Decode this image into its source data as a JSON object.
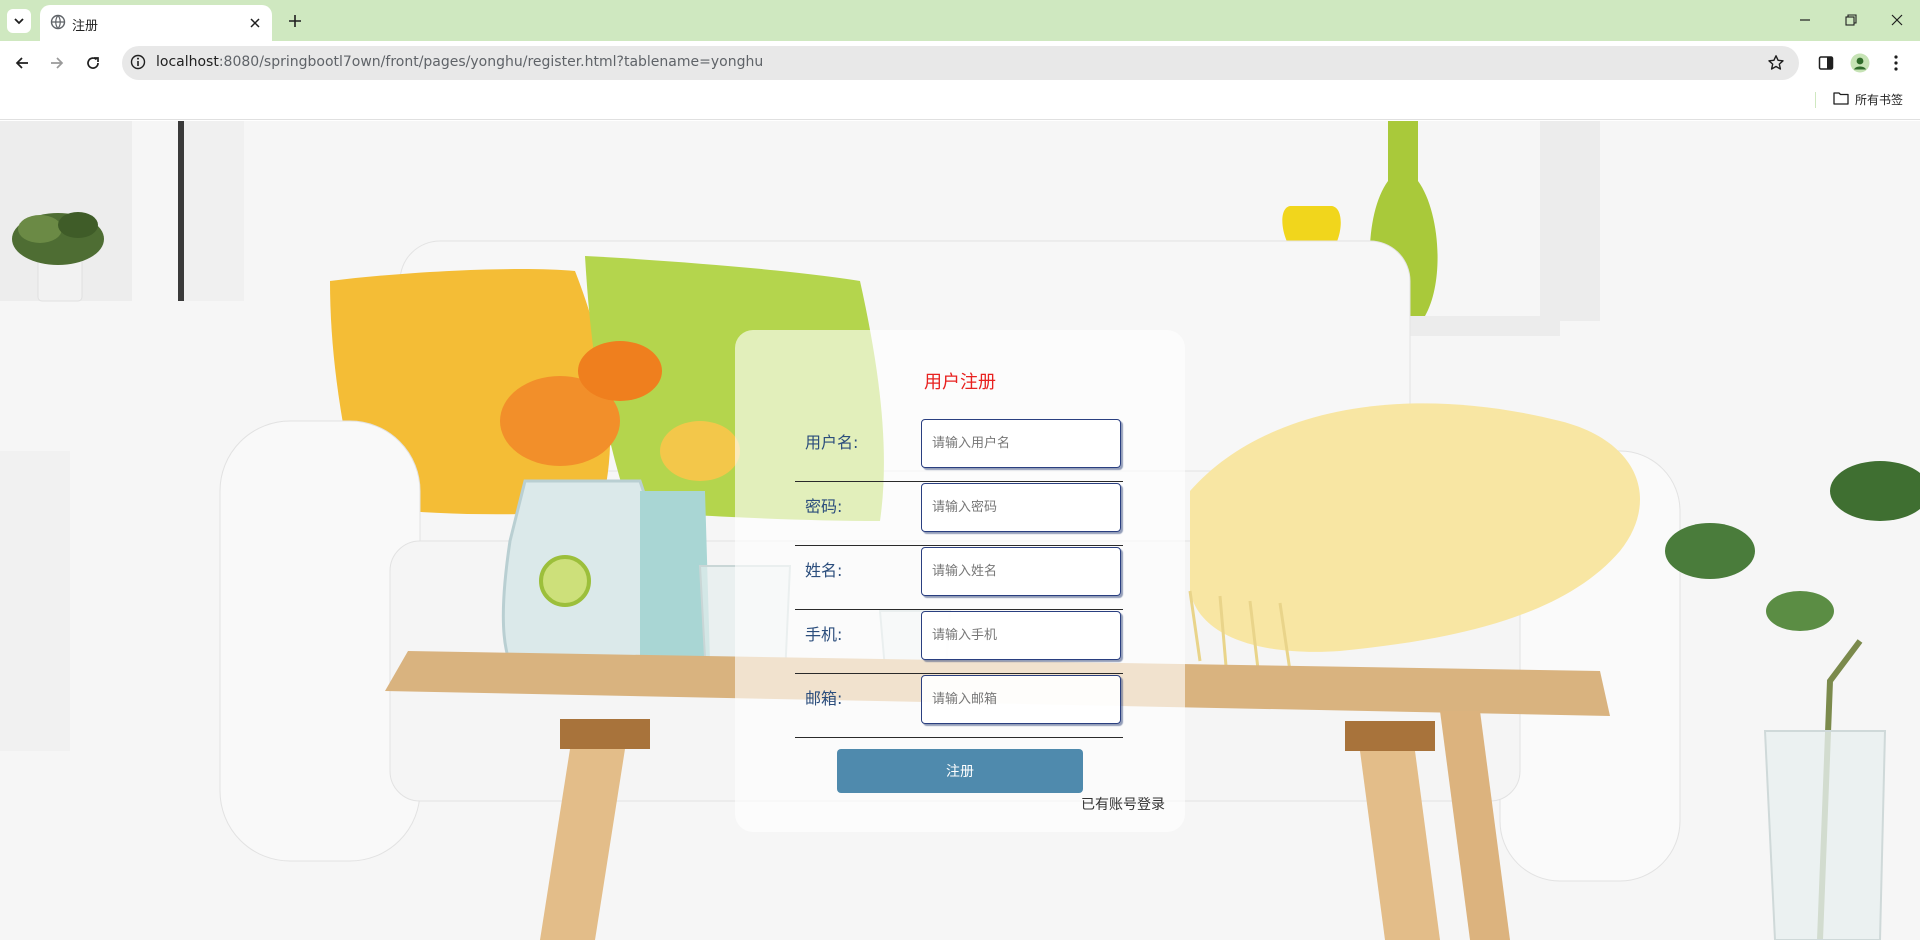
{
  "browser": {
    "tab_title": "注册",
    "url_host": "localhost",
    "url_rest": ":8080/springbootl7own/front/pages/yonghu/register.html?tablename=yonghu",
    "bookmarks_label": "所有书签"
  },
  "form": {
    "title": "用户注册",
    "fields": [
      {
        "label": "用户名:",
        "placeholder": "请输入用户名"
      },
      {
        "label": "密码:",
        "placeholder": "请输入密码"
      },
      {
        "label": "姓名:",
        "placeholder": "请输入姓名"
      },
      {
        "label": "手机:",
        "placeholder": "请输入手机"
      },
      {
        "label": "邮箱:",
        "placeholder": "请输入邮箱"
      }
    ],
    "submit_label": "注册",
    "login_link": "已有账号登录"
  },
  "colors": {
    "title": "#e8211f",
    "button": "#4f8aad",
    "label": "#2b4d7c",
    "tabbar": "#cfe8c0"
  },
  "icons": [
    "tab-search-icon",
    "globe-icon",
    "close-icon",
    "plus-icon",
    "minimize-icon",
    "restore-icon",
    "back-icon",
    "forward-icon",
    "reload-icon",
    "site-info-icon",
    "star-icon",
    "side-panel-icon",
    "profile-icon",
    "menu-icon",
    "folder-icon"
  ]
}
